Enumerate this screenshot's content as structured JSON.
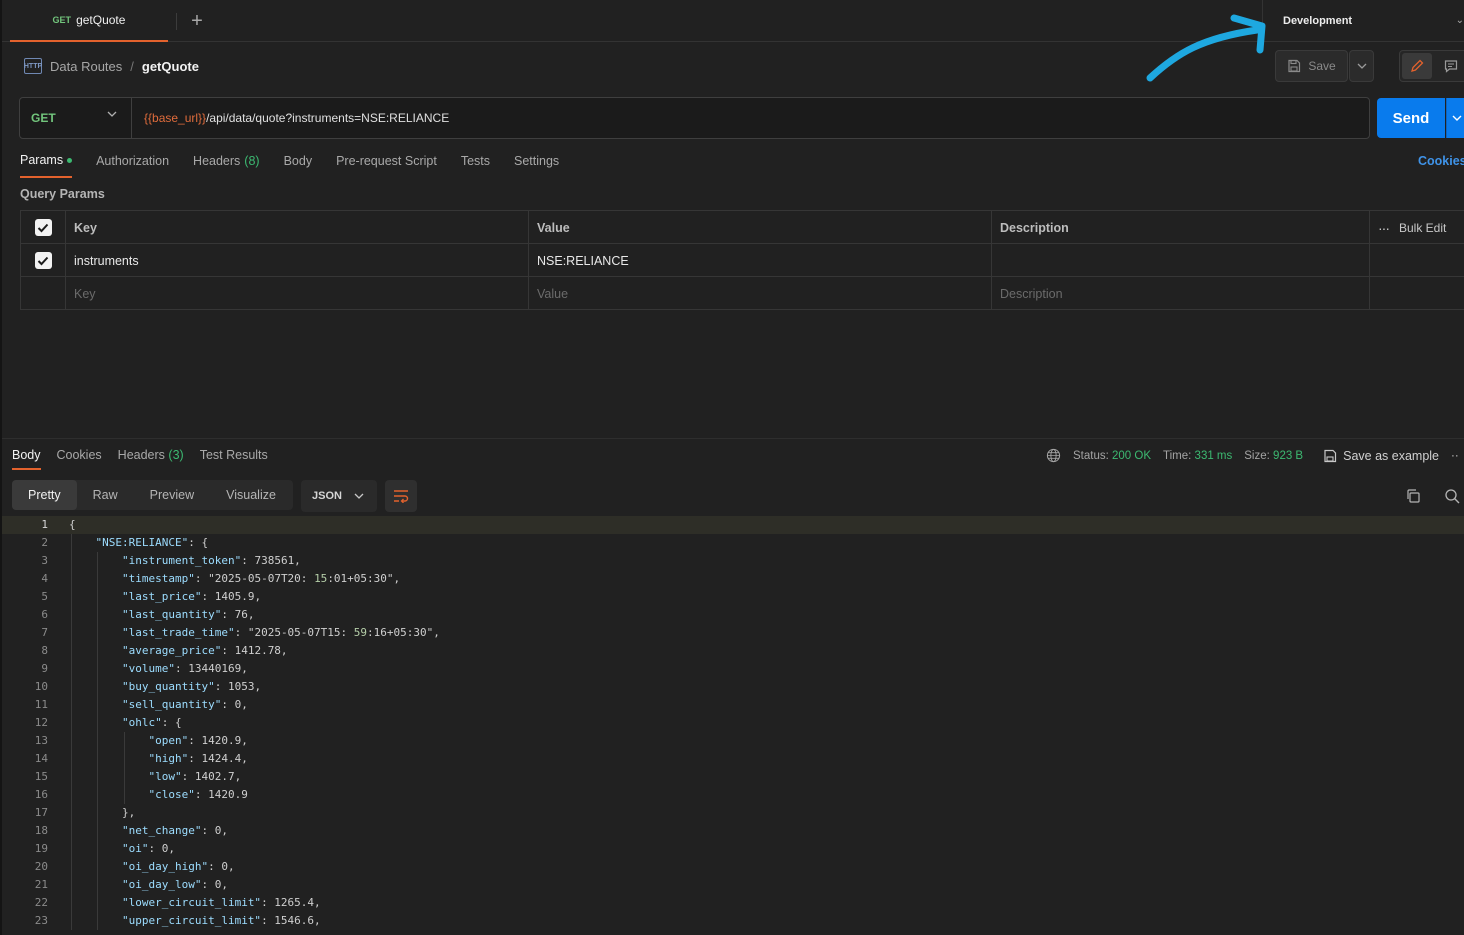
{
  "tab": {
    "method": "GET",
    "name": "getQuote"
  },
  "environment": {
    "label": "Development"
  },
  "breadcrumb": {
    "icon_text": "HTTP",
    "parent": "Data Routes",
    "separator": "/",
    "current": "getQuote"
  },
  "toolbar": {
    "save_label": "Save"
  },
  "request": {
    "method": "GET",
    "url_variable": "{{base_url}}",
    "url_path": "/api/data/quote?instruments=NSE:RELIANCE",
    "send_label": "Send"
  },
  "request_tabs": [
    {
      "label": "Params"
    },
    {
      "label": "Authorization"
    },
    {
      "label": "Headers",
      "count": "(8)"
    },
    {
      "label": "Body"
    },
    {
      "label": "Pre-request Script"
    },
    {
      "label": "Tests"
    },
    {
      "label": "Settings"
    }
  ],
  "cookies_label": "Cookies",
  "query_params": {
    "title": "Query Params",
    "headers": {
      "key": "Key",
      "value": "Value",
      "description": "Description",
      "bulk_edit": "Bulk Edit"
    },
    "rows": [
      {
        "key": "instruments",
        "value": "NSE:RELIANCE",
        "description": ""
      }
    ],
    "placeholders": {
      "key": "Key",
      "value": "Value",
      "description": "Description"
    }
  },
  "response": {
    "tabs": [
      {
        "label": "Body"
      },
      {
        "label": "Cookies"
      },
      {
        "label": "Headers",
        "count": "(3)"
      },
      {
        "label": "Test Results"
      }
    ],
    "status_label": "Status:",
    "status_value": "200 OK",
    "time_label": "Time:",
    "time_value": "331 ms",
    "size_label": "Size:",
    "size_value": "923 B",
    "save_example": "Save as example",
    "view_modes": [
      "Pretty",
      "Raw",
      "Preview",
      "Visualize"
    ],
    "format": "JSON"
  },
  "code_lines": [
    "{",
    "    \"NSE:RELIANCE\": {",
    "        \"instrument_token\": 738561,",
    "        \"timestamp\": \"2025-05-07T20:15:01+05:30\",",
    "        \"last_price\": 1405.9,",
    "        \"last_quantity\": 76,",
    "        \"last_trade_time\": \"2025-05-07T15:59:16+05:30\",",
    "        \"average_price\": 1412.78,",
    "        \"volume\": 13440169,",
    "        \"buy_quantity\": 1053,",
    "        \"sell_quantity\": 0,",
    "        \"ohlc\": {",
    "            \"open\": 1420.9,",
    "            \"high\": 1424.4,",
    "            \"low\": 1402.7,",
    "            \"close\": 1420.9",
    "        },",
    "        \"net_change\": 0,",
    "        \"oi\": 0,",
    "        \"oi_day_high\": 0,",
    "        \"oi_day_low\": 0,",
    "        \"lower_circuit_limit\": 1265.4,",
    "        \"upper_circuit_limit\": 1546.6,"
  ],
  "colors": {
    "accent": "#e3622d",
    "send": "#097bed",
    "success": "#3cb971",
    "link": "#3f93e8",
    "annotation": "#1ea8e0"
  }
}
